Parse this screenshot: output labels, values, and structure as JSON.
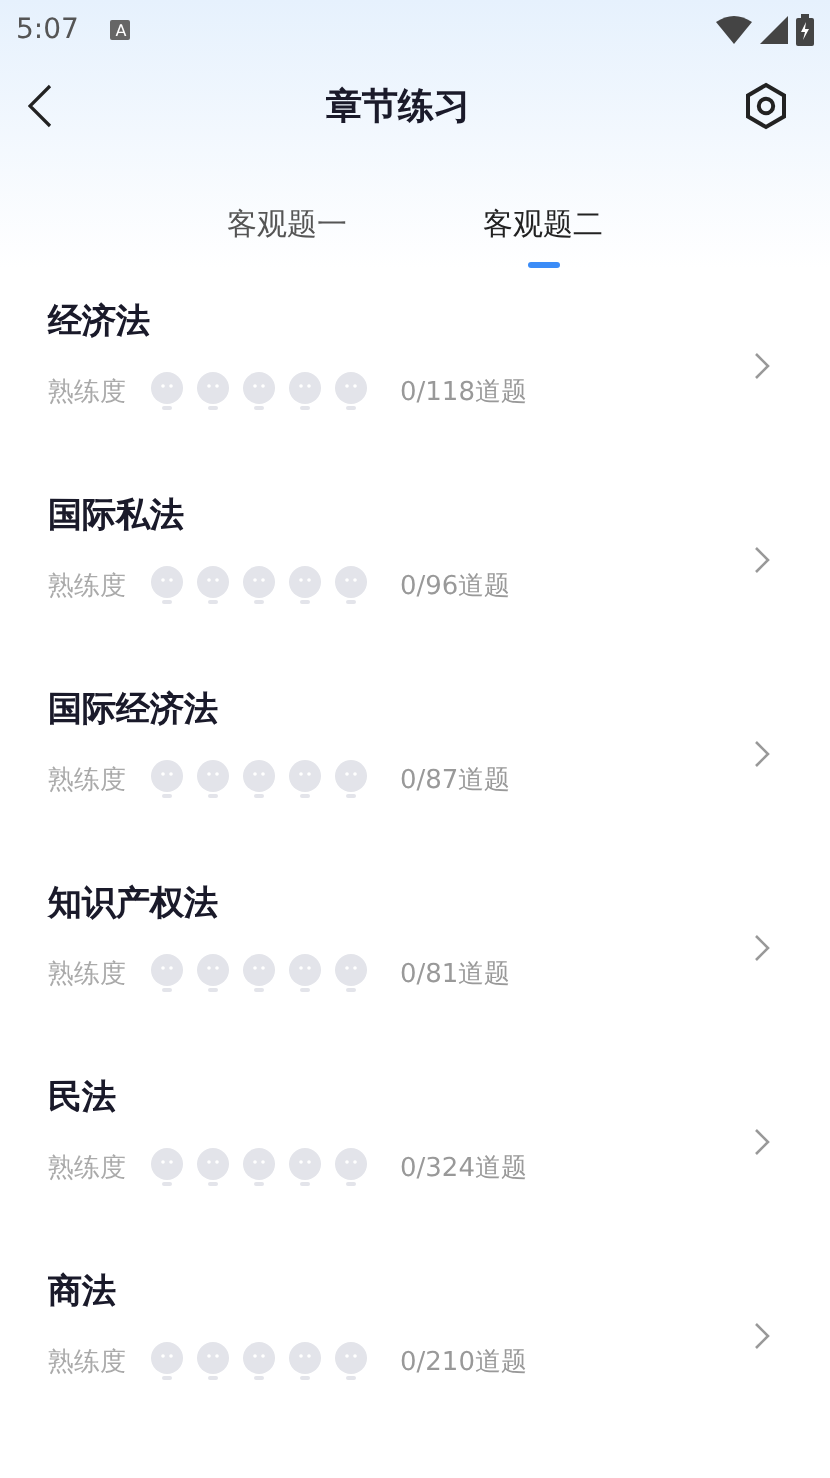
{
  "status_bar": {
    "time": "5:07",
    "badge": "A"
  },
  "header": {
    "title": "章节练习"
  },
  "tabs": [
    {
      "label": "客观题一",
      "selected": false
    },
    {
      "label": "客观题二",
      "selected": true
    }
  ],
  "chapters": [
    {
      "title": "经济法",
      "label": "熟练度",
      "stars": 0,
      "count": "0/118道题"
    },
    {
      "title": "国际私法",
      "label": "熟练度",
      "stars": 0,
      "count": "0/96道题"
    },
    {
      "title": "国际经济法",
      "label": "熟练度",
      "stars": 0,
      "count": "0/87道题"
    },
    {
      "title": "知识产权法",
      "label": "熟练度",
      "stars": 0,
      "count": "0/81道题"
    },
    {
      "title": "民法",
      "label": "熟练度",
      "stars": 0,
      "count": "0/324道题"
    },
    {
      "title": "商法",
      "label": "熟练度",
      "stars": 0,
      "count": "0/210道题"
    }
  ]
}
